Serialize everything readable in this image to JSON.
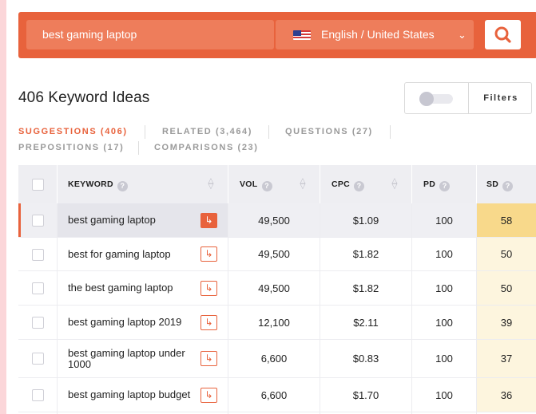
{
  "search": {
    "query": "best gaming laptop",
    "language": "English / United States",
    "flag_icon": "us-flag-icon",
    "accent_color": "#e8623c"
  },
  "header": {
    "title": "406 Keyword Ideas",
    "filters_label": "Filters"
  },
  "tabs": [
    {
      "label": "SUGGESTIONS (406)",
      "active": true
    },
    {
      "label": "RELATED (3,464)",
      "active": false
    },
    {
      "label": "QUESTIONS (27)",
      "active": false
    },
    {
      "label": "PREPOSITIONS (17)",
      "active": false
    },
    {
      "label": "COMPARISONS (23)",
      "active": false
    }
  ],
  "table": {
    "columns": [
      "KEYWORD",
      "VOL",
      "CPC",
      "PD",
      "SD"
    ],
    "help_icon": "?",
    "rows": [
      {
        "keyword": "best gaming laptop",
        "vol": "49,500",
        "cpc": "$1.09",
        "pd": "100",
        "sd": "58",
        "sd_color": "#f8d98b",
        "selected": true
      },
      {
        "keyword": "best for gaming laptop",
        "vol": "49,500",
        "cpc": "$1.82",
        "pd": "100",
        "sd": "50",
        "sd_color": "#fdf5de",
        "selected": false
      },
      {
        "keyword": "the best gaming laptop",
        "vol": "49,500",
        "cpc": "$1.82",
        "pd": "100",
        "sd": "50",
        "sd_color": "#fdf5de",
        "selected": false
      },
      {
        "keyword": "best gaming laptop 2019",
        "vol": "12,100",
        "cpc": "$2.11",
        "pd": "100",
        "sd": "39",
        "sd_color": "#fdf5de",
        "selected": false
      },
      {
        "keyword": "best gaming laptop under 1000",
        "vol": "6,600",
        "cpc": "$0.83",
        "pd": "100",
        "sd": "37",
        "sd_color": "#fdf5de",
        "selected": false
      },
      {
        "keyword": "best gaming laptop budget",
        "vol": "6,600",
        "cpc": "$1.70",
        "pd": "100",
        "sd": "36",
        "sd_color": "#fdf5de",
        "selected": false
      }
    ]
  }
}
